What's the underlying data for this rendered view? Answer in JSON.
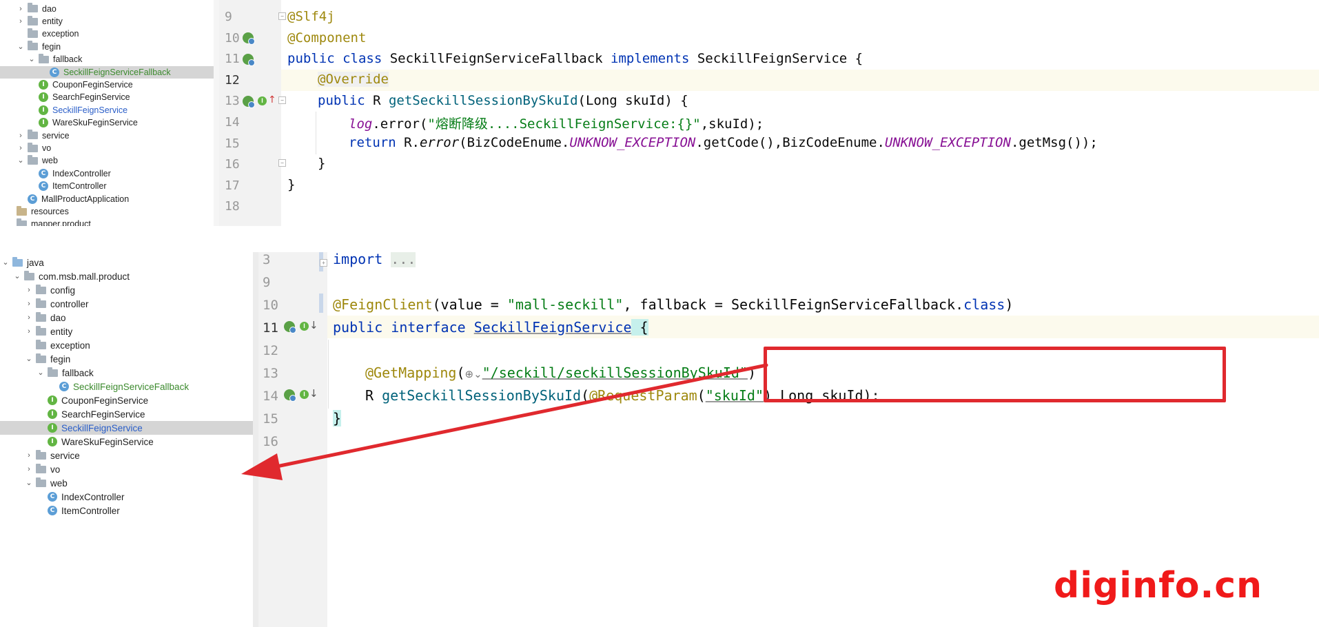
{
  "top_tree": [
    {
      "label": "dao",
      "type": "folder",
      "depth": 1,
      "arrow": "›"
    },
    {
      "label": "entity",
      "type": "folder",
      "depth": 1,
      "arrow": "›"
    },
    {
      "label": "exception",
      "type": "folder",
      "depth": 1,
      "arrow": ""
    },
    {
      "label": "fegin",
      "type": "folder",
      "depth": 1,
      "arrow": "⌄"
    },
    {
      "label": "fallback",
      "type": "folder",
      "depth": 2,
      "arrow": "⌄"
    },
    {
      "label": "SeckillFeignServiceFallback",
      "type": "class",
      "depth": 3,
      "arrow": "",
      "selected": true,
      "color": "green"
    },
    {
      "label": "CouponFeginService",
      "type": "interface",
      "depth": 2,
      "arrow": ""
    },
    {
      "label": "SearchFeginService",
      "type": "interface",
      "depth": 2,
      "arrow": ""
    },
    {
      "label": "SeckillFeignService",
      "type": "interface",
      "depth": 2,
      "arrow": "",
      "color": "blue"
    },
    {
      "label": "WareSkuFeginService",
      "type": "interface",
      "depth": 2,
      "arrow": ""
    },
    {
      "label": "service",
      "type": "folder",
      "depth": 1,
      "arrow": "›"
    },
    {
      "label": "vo",
      "type": "folder",
      "depth": 1,
      "arrow": "›"
    },
    {
      "label": "web",
      "type": "folder",
      "depth": 1,
      "arrow": "⌄"
    },
    {
      "label": "IndexController",
      "type": "class",
      "depth": 2,
      "arrow": ""
    },
    {
      "label": "ItemController",
      "type": "class",
      "depth": 2,
      "arrow": ""
    },
    {
      "label": "MallProductApplication",
      "type": "app",
      "depth": 1,
      "arrow": ""
    },
    {
      "label": "resources",
      "type": "resfolder",
      "depth": 0,
      "arrow": ""
    },
    {
      "label": "mapper.product",
      "type": "folder",
      "depth": 0,
      "arrow": ""
    }
  ],
  "bottom_tree": [
    {
      "label": "java",
      "type": "bluefolder",
      "depth": 0,
      "arrow": "⌄"
    },
    {
      "label": "com.msb.mall.product",
      "type": "folder",
      "depth": 1,
      "arrow": "⌄"
    },
    {
      "label": "config",
      "type": "folder",
      "depth": 2,
      "arrow": "›"
    },
    {
      "label": "controller",
      "type": "folder",
      "depth": 2,
      "arrow": "›"
    },
    {
      "label": "dao",
      "type": "folder",
      "depth": 2,
      "arrow": "›"
    },
    {
      "label": "entity",
      "type": "folder",
      "depth": 2,
      "arrow": "›"
    },
    {
      "label": "exception",
      "type": "folder",
      "depth": 2,
      "arrow": ""
    },
    {
      "label": "fegin",
      "type": "folder",
      "depth": 2,
      "arrow": "⌄"
    },
    {
      "label": "fallback",
      "type": "folder",
      "depth": 3,
      "arrow": "⌄"
    },
    {
      "label": "SeckillFeignServiceFallback",
      "type": "class",
      "depth": 4,
      "arrow": "",
      "color": "green"
    },
    {
      "label": "CouponFeginService",
      "type": "interface",
      "depth": 3,
      "arrow": ""
    },
    {
      "label": "SearchFeginService",
      "type": "interface",
      "depth": 3,
      "arrow": ""
    },
    {
      "label": "SeckillFeignService",
      "type": "interface",
      "depth": 3,
      "arrow": "",
      "selected": true,
      "color": "blue"
    },
    {
      "label": "WareSkuFeginService",
      "type": "interface",
      "depth": 3,
      "arrow": ""
    },
    {
      "label": "service",
      "type": "folder",
      "depth": 2,
      "arrow": "›"
    },
    {
      "label": "vo",
      "type": "folder",
      "depth": 2,
      "arrow": "›"
    },
    {
      "label": "web",
      "type": "folder",
      "depth": 2,
      "arrow": "⌄"
    },
    {
      "label": "IndexController",
      "type": "class",
      "depth": 3,
      "arrow": ""
    },
    {
      "label": "ItemController",
      "type": "class",
      "depth": 3,
      "arrow": ""
    }
  ],
  "top_editor": {
    "lines": [
      "9",
      "10",
      "11",
      "12",
      "13",
      "14",
      "15",
      "16",
      "17",
      "18"
    ],
    "code": {
      "l9_ann": "@Slf4j",
      "l10_ann": "@Component",
      "l11_kw1": "public class ",
      "l11_name": "SeckillFeignServiceFallback ",
      "l11_kw2": "implements ",
      "l11_rest": "SeckillFeignService {",
      "l12_ann": "@Override",
      "l13_kw": "public ",
      "l13_r": "R ",
      "l13_fn": "getSeckillSessionBySkuId",
      "l13_rest": "(Long skuId) {",
      "l14_log": "log",
      "l14_a": ".error(",
      "l14_str": "\"熔断降级....SeckillFeignService:{}\"",
      "l14_b": ",skuId);",
      "l15_kw": "return ",
      "l15_a": "R.",
      "l15_err": "error",
      "l15_b": "(BizCodeEnume.",
      "l15_c1": "UNKNOW_EXCEPTION",
      "l15_d": ".getCode(),BizCodeEnume.",
      "l15_c2": "UNKNOW_EXCEPTION",
      "l15_e": ".getMsg());",
      "l16": "}",
      "l17": "}"
    }
  },
  "bottom_editor": {
    "lines": [
      "3",
      "9",
      "10",
      "11",
      "12",
      "13",
      "14",
      "15",
      "16"
    ],
    "code": {
      "l3_kw": "import ",
      "l3_dots": "...",
      "l10_ann": "@FeignClient",
      "l10_a": "(value = ",
      "l10_str": "\"mall-seckill\"",
      "l10_b": ", fallback = SeckillFeignServiceFallback.",
      "l10_kw": "class",
      "l10_c": ")",
      "l11_kw": "public interface ",
      "l11_name": "SeckillFeignService",
      "l11_brace": " {",
      "l13_ann": "@GetMapping",
      "l13_a": "(",
      "l13_icon": "⊕⌄",
      "l13_str": "\"/seckill/seckillSessionBySkuId\"",
      "l13_b": ")",
      "l14_r": "R ",
      "l14_fn": "getSeckillSessionBySkuId",
      "l14_a": "(",
      "l14_ann": "@RequestParam",
      "l14_b": "(",
      "l14_str": "\"skuId\"",
      "l14_c": ") Long skuId);",
      "l15": "}"
    }
  },
  "watermark": "diginfo.cn",
  "colors": {
    "highlight_box": "#e0292e",
    "watermark": "#f01a1a",
    "selection": "#d5d5d5"
  }
}
